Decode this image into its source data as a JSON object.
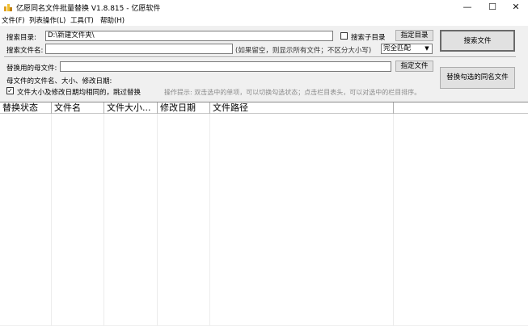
{
  "window": {
    "title": "亿愿同名文件批量替换 V1.8.815 - 亿愿软件",
    "minimize": "—",
    "maximize": "☐",
    "close": "✕"
  },
  "menu": [
    "文件(F)",
    "列表操作(L)",
    "工具(T)",
    "帮助(H)"
  ],
  "search": {
    "dir_label": "搜索目录:",
    "dir_value": "D:\\新建文件夹\\",
    "subdir_label": "搜索子目录",
    "subdir_checked": false,
    "choose_dir_button": "指定目录",
    "search_button": "搜索文件",
    "filename_label": "搜索文件名:",
    "filename_value": "",
    "filename_hint": "(如果留空，则显示所有文件；不区分大小写)",
    "match_mode": "完全匹配"
  },
  "replace": {
    "mother_label": "替换用的母文件:",
    "mother_value": "",
    "choose_file_button": "指定文件",
    "info_label": "母文件的文件名、大小、修改日期:",
    "skip_label": "文件大小及修改日期均相同的，跳过替换",
    "skip_checked": true,
    "hint": "操作提示: 双击选中的单项，可以切换勾选状态；点击栏目表头，可以对选中的栏目排序。",
    "replace_button": "替换勾选的同名文件"
  },
  "table": {
    "columns": [
      "替换状态",
      "文件名",
      "文件大小...",
      "修改日期",
      "文件路径"
    ],
    "rows": []
  }
}
